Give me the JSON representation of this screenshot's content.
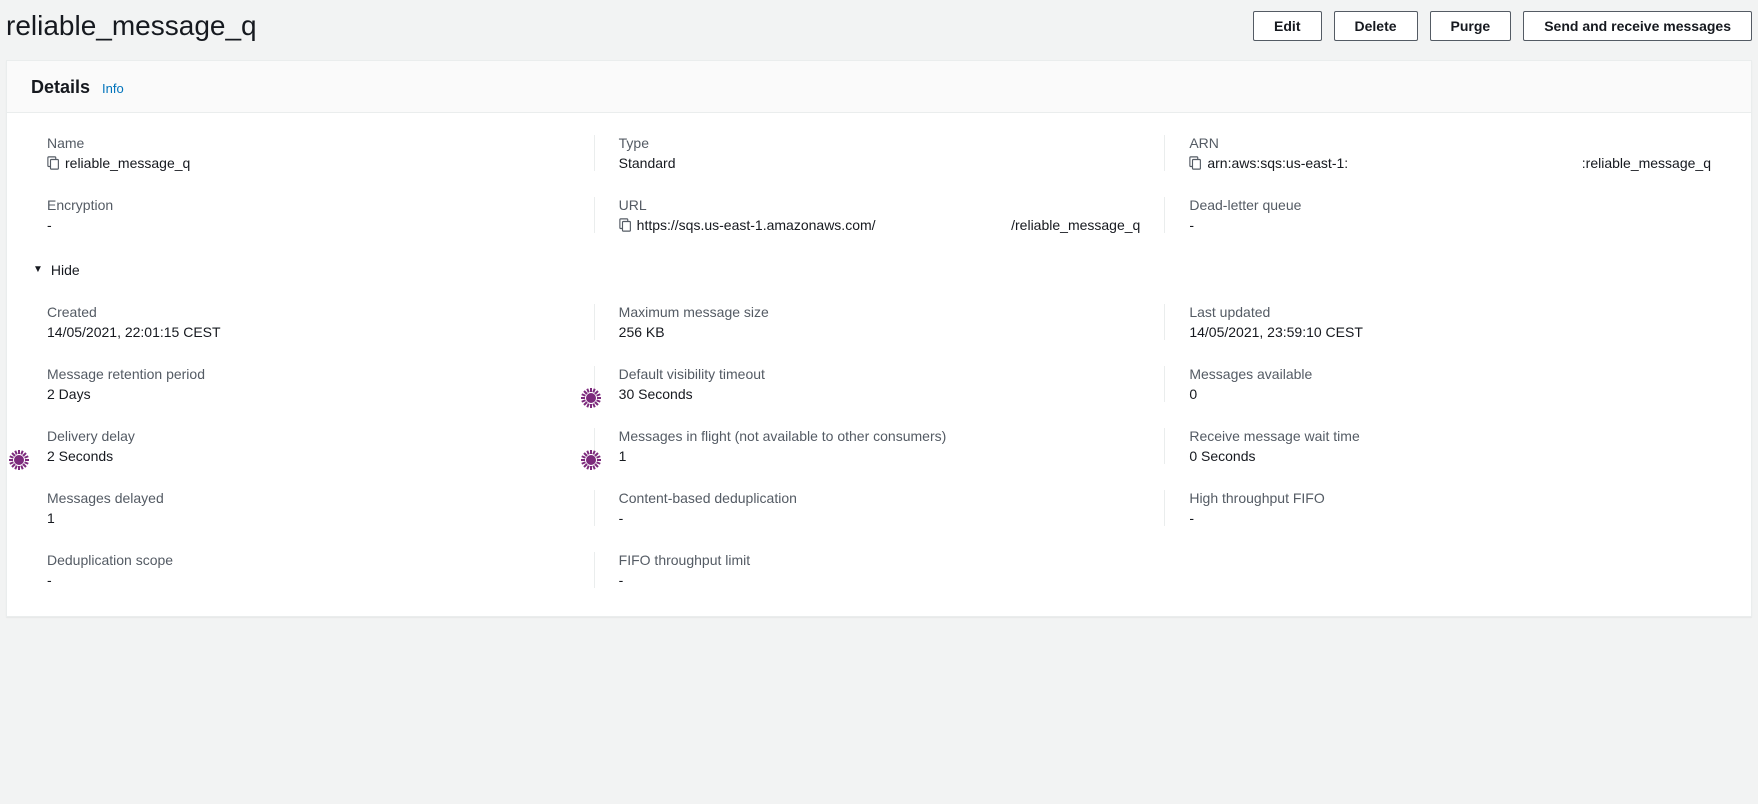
{
  "header": {
    "title": "reliable_message_q",
    "buttons": {
      "edit": "Edit",
      "delete": "Delete",
      "purge": "Purge",
      "send_receive": "Send and receive messages"
    }
  },
  "panel": {
    "title": "Details",
    "info": "Info",
    "toggle": "Hide"
  },
  "fields": {
    "name": {
      "label": "Name",
      "value": "reliable_message_q"
    },
    "type": {
      "label": "Type",
      "value": "Standard"
    },
    "arn": {
      "label": "ARN",
      "prefix": "arn:aws:sqs:us-east-1:",
      "suffix": ":reliable_message_q"
    },
    "encryption": {
      "label": "Encryption",
      "value": "-"
    },
    "url": {
      "label": "URL",
      "prefix": "https://sqs.us-east-1.amazonaws.com/",
      "suffix": "/reliable_message_q"
    },
    "dlq": {
      "label": "Dead-letter queue",
      "value": "-"
    },
    "created": {
      "label": "Created",
      "value": "14/05/2021, 22:01:15 CEST"
    },
    "max_msg_size": {
      "label": "Maximum message size",
      "value": "256 KB"
    },
    "last_updated": {
      "label": "Last updated",
      "value": "14/05/2021, 23:59:10 CEST"
    },
    "retention": {
      "label": "Message retention period",
      "value": "2 Days"
    },
    "visibility_timeout": {
      "label": "Default visibility timeout",
      "value": "30 Seconds"
    },
    "msgs_available": {
      "label": "Messages available",
      "value": "0"
    },
    "delivery_delay": {
      "label": "Delivery delay",
      "value": "2 Seconds"
    },
    "in_flight": {
      "label": "Messages in flight (not available to other consumers)",
      "value": "1"
    },
    "receive_wait": {
      "label": "Receive message wait time",
      "value": "0 Seconds"
    },
    "msgs_delayed": {
      "label": "Messages delayed",
      "value": "1"
    },
    "content_dedup": {
      "label": "Content-based deduplication",
      "value": "-"
    },
    "high_throughput": {
      "label": "High throughput FIFO",
      "value": "-"
    },
    "dedup_scope": {
      "label": "Deduplication scope",
      "value": "-"
    },
    "fifo_limit": {
      "label": "FIFO throughput limit",
      "value": "-"
    }
  }
}
